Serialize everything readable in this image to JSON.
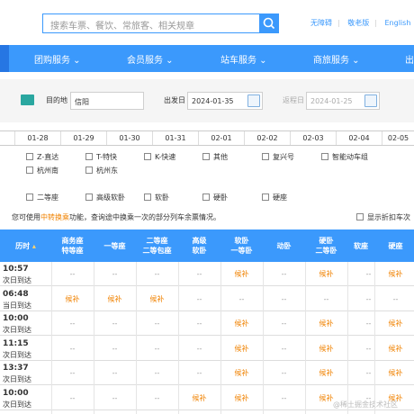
{
  "search": {
    "placeholder": "搜索车票、餐饮、常旅客、相关规章"
  },
  "toplinks": [
    "无障碍",
    "敬老版",
    "English"
  ],
  "nav": [
    "团购服务",
    "会员服务",
    "站车服务",
    "商旅服务",
    "出"
  ],
  "filter": {
    "dest_label": "目的地",
    "dest_value": "信阳",
    "depart_label": "出发日",
    "depart_value": "2024-01-35",
    "return_label": "返程日",
    "return_value": "2024-01-25"
  },
  "dates": [
    "01-28",
    "01-29",
    "01-30",
    "01-31",
    "02-01",
    "02-02",
    "02-03",
    "02-04",
    "02-05"
  ],
  "train_types": [
    "Z-直达",
    "T-特快",
    "K-快速",
    "其他",
    "复兴号",
    "智能动车组"
  ],
  "stations": [
    "杭州南",
    "杭州东"
  ],
  "seat_types": [
    "二等座",
    "高级软卧",
    "软卧",
    "硬卧",
    "硬座"
  ],
  "info": {
    "prefix": "您可使用",
    "highlight": "中转换乘",
    "suffix": "功能，查询途中换乘一次的部分列车余票情况。"
  },
  "show_price_label": "显示折扣车次",
  "table": {
    "headers": [
      "历时",
      "商务座\n特等座",
      "一等座",
      "二等座\n二等包座",
      "高级\n软卧",
      "软卧\n一等卧",
      "动卧",
      "硬卧\n二等卧",
      "软座",
      "硬座"
    ],
    "rows": [
      {
        "time": "10:57",
        "arr": "次日到达",
        "cells": [
          "--",
          "--",
          "--",
          "--",
          "候补",
          "--",
          "候补",
          "--",
          "候补"
        ]
      },
      {
        "time": "06:48",
        "arr": "当日到达",
        "cells": [
          "候补",
          "候补",
          "候补",
          "--",
          "--",
          "--",
          "--",
          "--",
          "--"
        ]
      },
      {
        "time": "10:00",
        "arr": "次日到达",
        "cells": [
          "--",
          "--",
          "--",
          "--",
          "候补",
          "--",
          "候补",
          "--",
          "候补"
        ]
      },
      {
        "time": "11:15",
        "arr": "次日到达",
        "cells": [
          "--",
          "--",
          "--",
          "--",
          "候补",
          "--",
          "候补",
          "--",
          "候补"
        ]
      },
      {
        "time": "13:37",
        "arr": "次日到达",
        "cells": [
          "--",
          "--",
          "--",
          "--",
          "候补",
          "--",
          "候补",
          "--",
          "候补"
        ]
      },
      {
        "time": "10:00",
        "arr": "次日到达",
        "cells": [
          "--",
          "--",
          "--",
          "候补",
          "候补",
          "--",
          "候补",
          "--",
          "候补"
        ]
      }
    ]
  },
  "watermark": "@稀土掘金技术社区",
  "colors": {
    "primary": "#3b99fc",
    "accent": "#f08200"
  }
}
